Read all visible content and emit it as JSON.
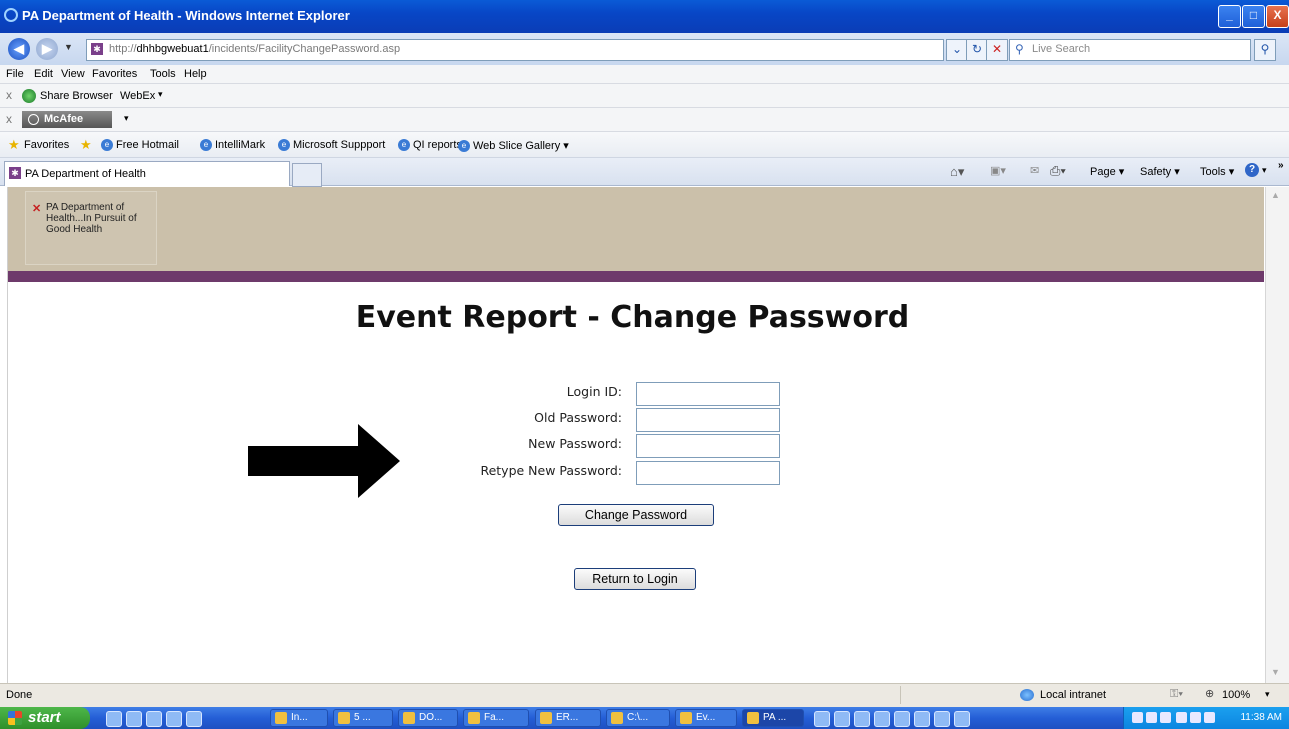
{
  "window": {
    "title": "PA Department of Health - Windows Internet Explorer",
    "minimize": "_",
    "maximize": "□",
    "close": "X"
  },
  "nav": {
    "back": "◀",
    "forward": "▶",
    "url_prefix": "http://",
    "url_host": "dhhbgwebuat1",
    "url_path": "/incidents/FacilityChangePassword.asp",
    "search_placeholder": "Live Search"
  },
  "menu": [
    "File",
    "Edit",
    "View",
    "Favorites",
    "Tools",
    "Help"
  ],
  "toolbar": {
    "share_browser": "Share Browser",
    "webex": "WebEx",
    "mcafee": "McAfee"
  },
  "favorites": {
    "label": "Favorites",
    "items": [
      "Free Hotmail",
      "IntelliMark",
      "Microsoft Suppport",
      "QI reports",
      "Web Slice Gallery"
    ]
  },
  "tab": {
    "label": "PA Department of Health"
  },
  "command_bar": {
    "page": "Page",
    "safety": "Safety",
    "tools": "Tools"
  },
  "banner": {
    "logo_alt": "PA Department of Health...In Pursuit of Good Health"
  },
  "page": {
    "title": "Event Report - Change Password",
    "fields": [
      {
        "label": "Login ID:",
        "value": ""
      },
      {
        "label": "Old Password:",
        "value": ""
      },
      {
        "label": "New Password:",
        "value": ""
      },
      {
        "label": "Retype New Password:",
        "value": ""
      }
    ],
    "change_button": "Change Password",
    "return_button": "Return to Login"
  },
  "status": {
    "left": "Done",
    "zone": "Local intranet",
    "zoom": "100%"
  },
  "taskbar": {
    "start": "start",
    "tasks": [
      "In...",
      "5 ...",
      "DO...",
      "Fa...",
      "ER...",
      "C:\\...",
      "Ev...",
      "PA ..."
    ],
    "clock": "11:38 AM"
  },
  "colors": {
    "banner": "#cbc0aa",
    "purple_stripe": "#6e3a6b",
    "titlebar": "#0846c6"
  }
}
